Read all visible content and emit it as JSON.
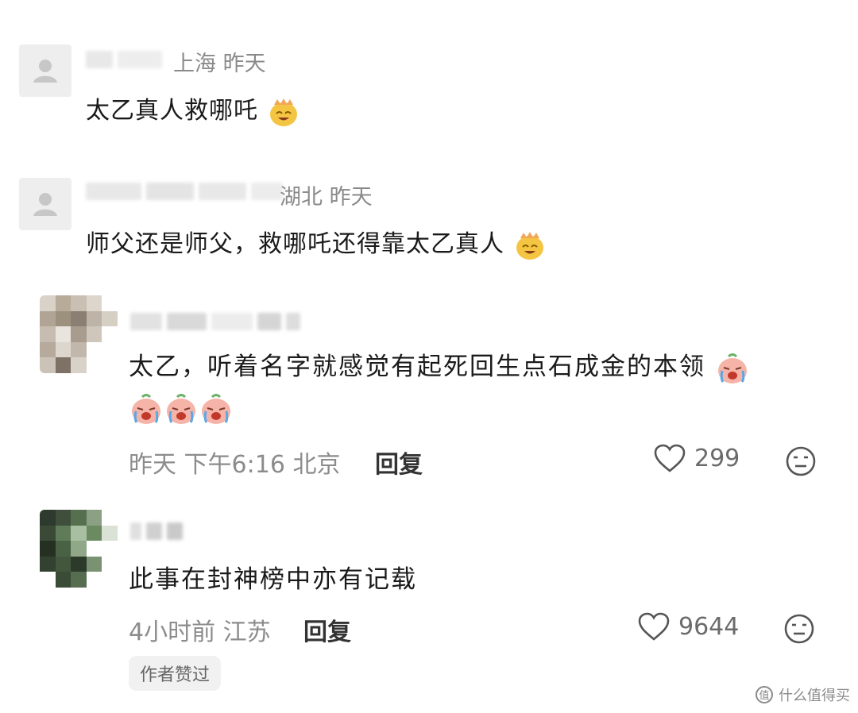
{
  "comments": [
    {
      "location_time": "上海  昨天",
      "text": "太乙真人救哪吒"
    },
    {
      "location_time": "湖北  昨天",
      "text": "师父还是师父，救哪吒还得靠太乙真人"
    },
    {
      "text": "太乙，听着名字就感觉有起死回生点石成金的本领",
      "footer": "昨天  下午6:16  北京",
      "reply_label": "回复",
      "likes": "299"
    },
    {
      "text": "此事在封神榜中亦有记载",
      "footer": "4小时前  江苏",
      "reply_label": "回复",
      "likes": "9644",
      "badge": "作者赞过"
    }
  ],
  "watermark": {
    "text": "什么值得买"
  },
  "colors": {
    "text": "#1a1a1a",
    "meta": "#8a8a8a",
    "icon": "#555555"
  }
}
